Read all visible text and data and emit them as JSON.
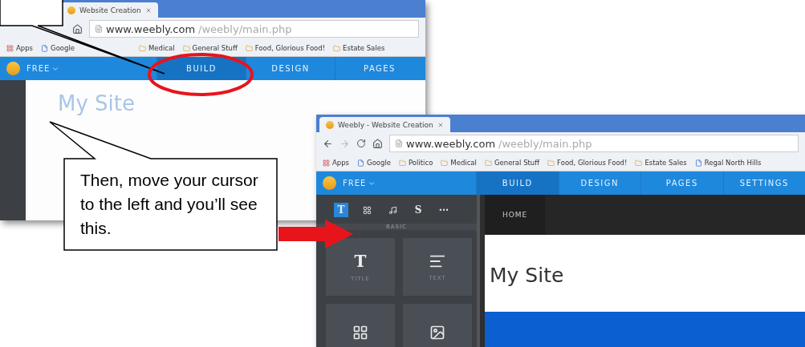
{
  "first_screenshot": {
    "tab_title": "Website Creation",
    "url_host": "www.weebly.com",
    "url_path": "/weebly/main.php",
    "bookmarks": [
      {
        "label": "Apps",
        "kind": "apps"
      },
      {
        "label": "Google",
        "kind": "page"
      },
      {
        "label": "Medical",
        "kind": "folder"
      },
      {
        "label": "General Stuff",
        "kind": "folder"
      },
      {
        "label": "Food, Glorious Food!",
        "kind": "folder"
      },
      {
        "label": "Estate Sales",
        "kind": "folder"
      }
    ],
    "plan": "FREE",
    "nav": [
      {
        "label": "BUILD",
        "selected": true
      },
      {
        "label": "DESIGN",
        "selected": false
      },
      {
        "label": "PAGES",
        "selected": false
      }
    ],
    "site_title": "My Site"
  },
  "second_screenshot": {
    "tab_title": "Weebly - Website Creation",
    "url_host": "www.weebly.com",
    "url_path": "/weebly/main.php",
    "bookmarks": [
      {
        "label": "Apps",
        "kind": "apps"
      },
      {
        "label": "Google",
        "kind": "page"
      },
      {
        "label": "Politico",
        "kind": "folder"
      },
      {
        "label": "Medical",
        "kind": "folder"
      },
      {
        "label": "General Stuff",
        "kind": "folder"
      },
      {
        "label": "Food, Glorious Food!",
        "kind": "folder"
      },
      {
        "label": "Estate Sales",
        "kind": "folder"
      },
      {
        "label": "Regal North Hills",
        "kind": "page"
      }
    ],
    "plan": "FREE",
    "nav": [
      {
        "label": "BUILD",
        "selected": true
      },
      {
        "label": "DESIGN",
        "selected": false
      },
      {
        "label": "PAGES",
        "selected": false
      },
      {
        "label": "SETTINGS",
        "selected": false
      }
    ],
    "sidebar": {
      "tools": [
        {
          "kind": "glyph",
          "label": "T",
          "selected": true
        },
        {
          "kind": "layout",
          "selected": false
        },
        {
          "kind": "music",
          "selected": false
        },
        {
          "kind": "glyph",
          "label": "S",
          "selected": false
        },
        {
          "kind": "glyph",
          "label": "···",
          "selected": false
        }
      ],
      "section": "BASIC",
      "tiles": [
        {
          "kind": "title",
          "glyph": "T",
          "label": "TITLE"
        },
        {
          "kind": "text",
          "label": "TEXT"
        },
        {
          "kind": "image-text"
        },
        {
          "kind": "image"
        }
      ]
    },
    "page_tab": "HOME",
    "site_title": "My Site"
  },
  "callout": "Then, move your cursor to the left and you’ll see this."
}
